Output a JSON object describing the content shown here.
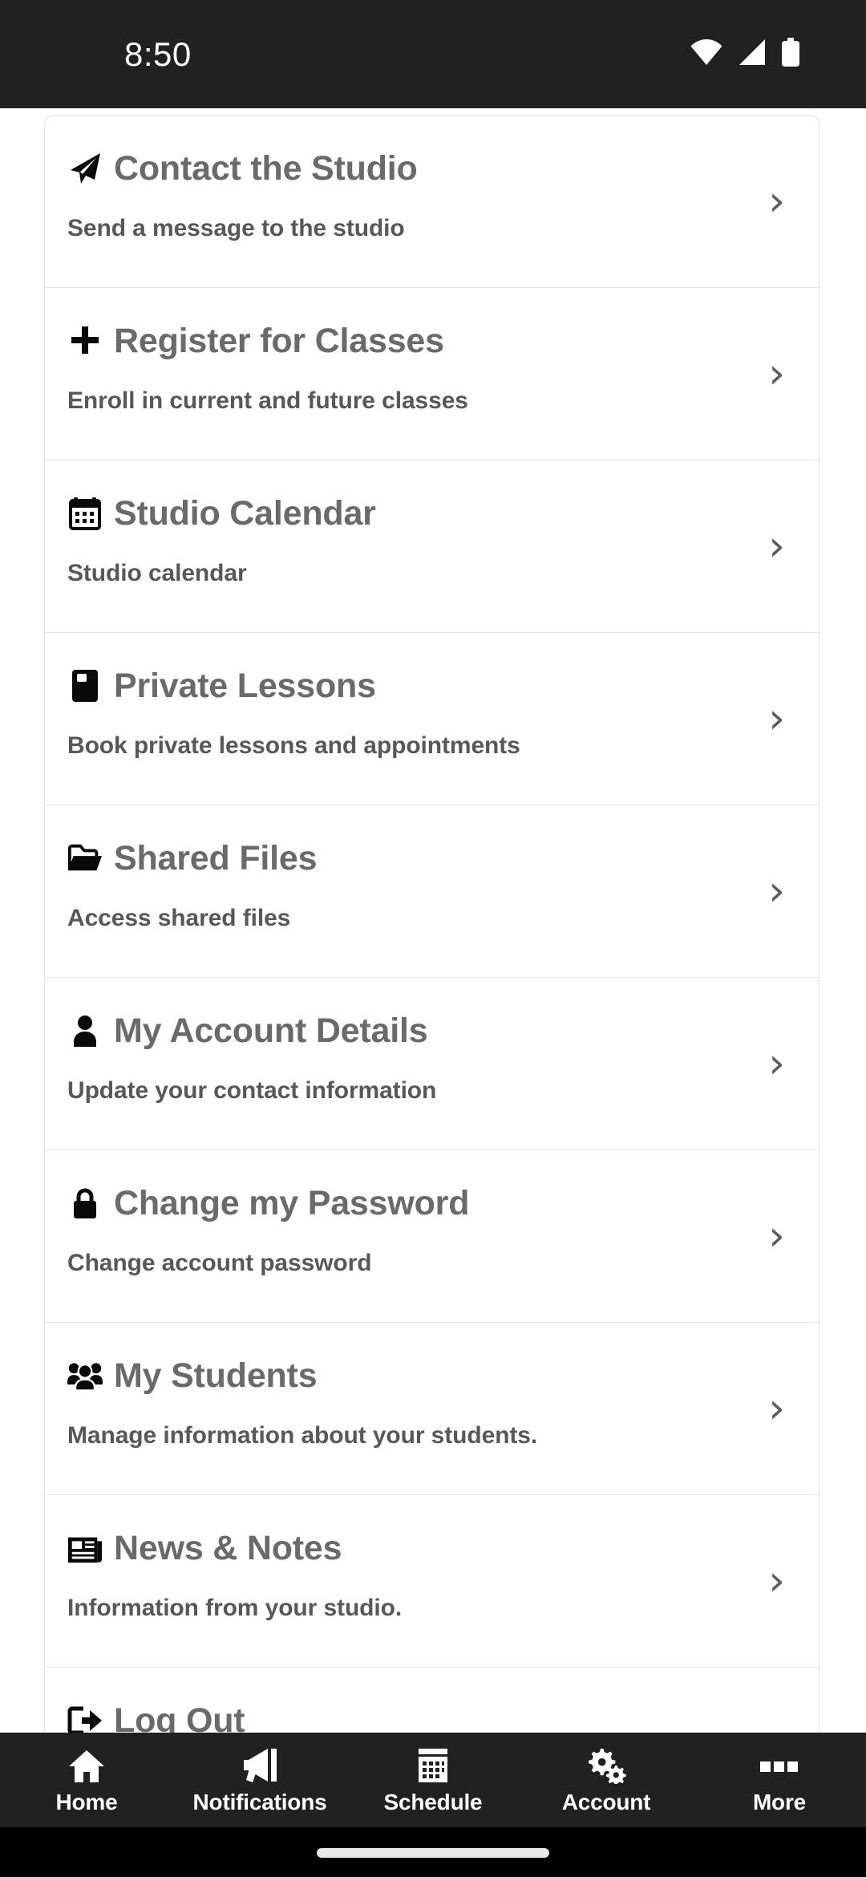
{
  "status_bar": {
    "time": "8:50",
    "icons": [
      "wifi-icon",
      "cellular-signal-icon",
      "battery-icon"
    ],
    "background_color": "#212121",
    "text_color": "#ffffff"
  },
  "menu": {
    "card_background": "#ffffff",
    "title_color": "#6a6a6a",
    "subtitle_color": "#585858",
    "divider_color": "#e4e4e4",
    "chevron_glyph": "›",
    "items": [
      {
        "icon": "paper-plane-icon",
        "title": "Contact the Studio",
        "subtitle": "Send a message to the studio"
      },
      {
        "icon": "plus-icon",
        "title": "Register for Classes",
        "subtitle": "Enroll in current and future classes"
      },
      {
        "icon": "calendar-icon",
        "title": "Studio Calendar",
        "subtitle": "Studio calendar"
      },
      {
        "icon": "book-icon",
        "title": "Private Lessons",
        "subtitle": "Book private lessons and appointments"
      },
      {
        "icon": "folder-open-icon",
        "title": "Shared Files",
        "subtitle": "Access shared files"
      },
      {
        "icon": "user-icon",
        "title": "My Account Details",
        "subtitle": "Update your contact information"
      },
      {
        "icon": "lock-icon",
        "title": "Change my Password",
        "subtitle": "Change account password"
      },
      {
        "icon": "users-group-icon",
        "title": "My Students",
        "subtitle": "Manage information about your students."
      },
      {
        "icon": "newspaper-icon",
        "title": "News & Notes",
        "subtitle": "Information from your studio."
      },
      {
        "icon": "sign-out-icon",
        "title": "Log Out",
        "subtitle": ""
      }
    ]
  },
  "bottom_nav": {
    "background_color": "#212121",
    "label_color": "#ffffff",
    "items": [
      {
        "icon": "home-icon",
        "label": "Home"
      },
      {
        "icon": "megaphone-icon",
        "label": "Notifications"
      },
      {
        "icon": "calendar-schedule-icon",
        "label": "Schedule"
      },
      {
        "icon": "gears-icon",
        "label": "Account"
      },
      {
        "icon": "more-squares-icon",
        "label": "More"
      }
    ]
  },
  "gesture_bar": {
    "background_color": "#000000",
    "indicator_color": "#e8e8e8"
  }
}
